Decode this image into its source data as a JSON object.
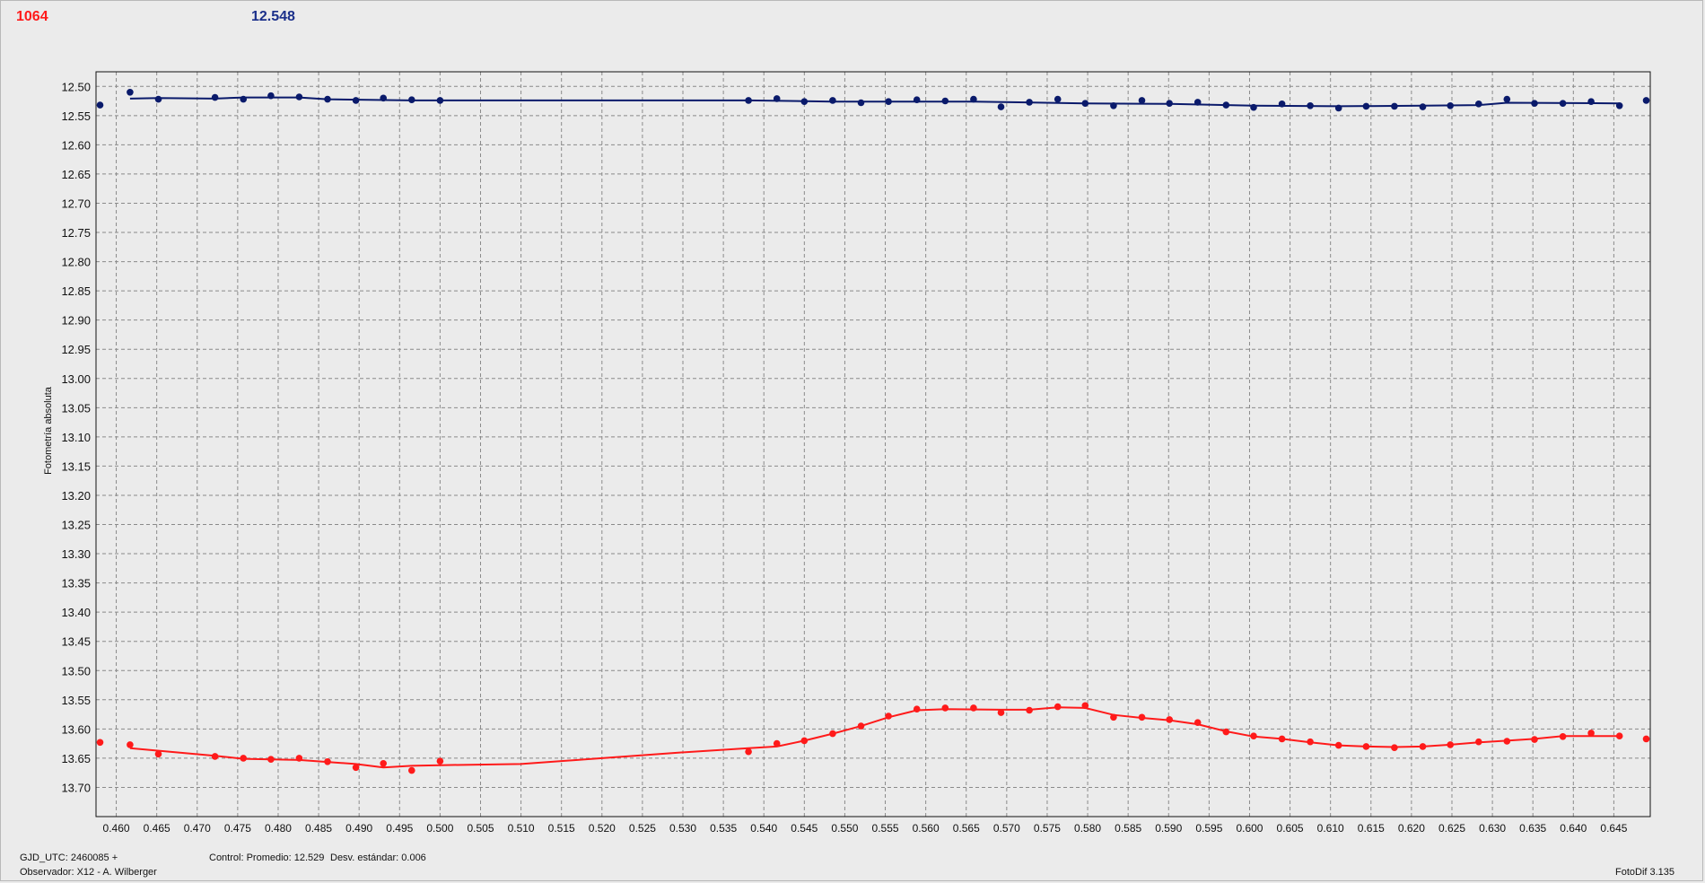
{
  "header": {
    "red_value": "1064",
    "blue_value": "12.548"
  },
  "footer": {
    "gjd": "GJD_UTC: 2460085 +",
    "observer": "Observador: X12 - A. Wilberger",
    "control": "Control: Promedio: 12.529",
    "desv": "Desv. estándar: 0.006",
    "app": "FotoDif 3.135"
  },
  "colors": {
    "blue": "#0a1a6b",
    "red": "#ff1a1a",
    "grid": "#8a8a8a",
    "background": "#ebebeb"
  },
  "chart_data": {
    "type": "scatter",
    "title": "",
    "xlabel": "",
    "ylabel": "Fotometría absoluta",
    "xlim": [
      0.4575,
      0.6495
    ],
    "ylim": [
      12.475,
      13.75
    ],
    "y_inverted": true,
    "grid": true,
    "x_ticks": [
      0.46,
      0.465,
      0.47,
      0.475,
      0.48,
      0.485,
      0.49,
      0.495,
      0.5,
      0.505,
      0.51,
      0.515,
      0.52,
      0.525,
      0.53,
      0.535,
      0.54,
      0.545,
      0.55,
      0.555,
      0.56,
      0.565,
      0.57,
      0.575,
      0.58,
      0.585,
      0.59,
      0.595,
      0.6,
      0.605,
      0.61,
      0.615,
      0.62,
      0.625,
      0.63,
      0.635,
      0.64,
      0.645
    ],
    "y_ticks": [
      12.5,
      12.55,
      12.6,
      12.65,
      12.7,
      12.75,
      12.8,
      12.85,
      12.9,
      12.95,
      13.0,
      13.05,
      13.1,
      13.15,
      13.2,
      13.25,
      13.3,
      13.35,
      13.4,
      13.45,
      13.5,
      13.55,
      13.6,
      13.65,
      13.7
    ],
    "series": [
      {
        "name": "",
        "color": "#0a1a6b",
        "points": [
          [
            0.458,
            12.532
          ],
          [
            0.4617,
            12.51
          ],
          [
            0.4652,
            12.522
          ],
          [
            0.4722,
            12.519
          ],
          [
            0.4757,
            12.522
          ],
          [
            0.4791,
            12.516
          ],
          [
            0.4826,
            12.518
          ],
          [
            0.4861,
            12.522
          ],
          [
            0.4896,
            12.524
          ],
          [
            0.493,
            12.52
          ],
          [
            0.4965,
            12.523
          ],
          [
            0.5,
            12.524
          ],
          [
            0.5381,
            12.524
          ],
          [
            0.5416,
            12.521
          ],
          [
            0.545,
            12.526
          ],
          [
            0.5485,
            12.524
          ],
          [
            0.552,
            12.528
          ],
          [
            0.5554,
            12.526
          ],
          [
            0.5589,
            12.523
          ],
          [
            0.5624,
            12.525
          ],
          [
            0.5659,
            12.522
          ],
          [
            0.5693,
            12.535
          ],
          [
            0.5728,
            12.527
          ],
          [
            0.5763,
            12.522
          ],
          [
            0.5797,
            12.529
          ],
          [
            0.5832,
            12.533
          ],
          [
            0.5867,
            12.524
          ],
          [
            0.5901,
            12.529
          ],
          [
            0.5936,
            12.527
          ],
          [
            0.5971,
            12.532
          ],
          [
            0.6005,
            12.536
          ],
          [
            0.604,
            12.53
          ],
          [
            0.6075,
            12.533
          ],
          [
            0.611,
            12.537
          ],
          [
            0.6144,
            12.534
          ],
          [
            0.6179,
            12.534
          ],
          [
            0.6214,
            12.535
          ],
          [
            0.6248,
            12.533
          ],
          [
            0.6283,
            12.53
          ],
          [
            0.6318,
            12.522
          ],
          [
            0.6352,
            12.529
          ],
          [
            0.6387,
            12.529
          ],
          [
            0.6422,
            12.526
          ],
          [
            0.6457,
            12.533
          ],
          [
            0.649,
            12.524
          ]
        ],
        "line": [
          [
            0.4617,
            12.521
          ],
          [
            0.4652,
            12.52
          ],
          [
            0.4722,
            12.521
          ],
          [
            0.4757,
            12.519
          ],
          [
            0.4826,
            12.519
          ],
          [
            0.4861,
            12.522
          ],
          [
            0.4965,
            12.524
          ],
          [
            0.5,
            12.524
          ],
          [
            0.5381,
            12.524
          ],
          [
            0.5485,
            12.526
          ],
          [
            0.5659,
            12.526
          ],
          [
            0.5797,
            12.529
          ],
          [
            0.5901,
            12.53
          ],
          [
            0.6005,
            12.533
          ],
          [
            0.611,
            12.534
          ],
          [
            0.6214,
            12.533
          ],
          [
            0.6283,
            12.532
          ],
          [
            0.6318,
            12.528
          ],
          [
            0.6457,
            12.529
          ]
        ]
      },
      {
        "name": "",
        "color": "#ff1a1a",
        "points": [
          [
            0.458,
            13.623
          ],
          [
            0.4617,
            13.627
          ],
          [
            0.4652,
            13.643
          ],
          [
            0.4722,
            13.647
          ],
          [
            0.4757,
            13.65
          ],
          [
            0.4791,
            13.652
          ],
          [
            0.4826,
            13.65
          ],
          [
            0.4861,
            13.656
          ],
          [
            0.4896,
            13.666
          ],
          [
            0.493,
            13.659
          ],
          [
            0.4965,
            13.671
          ],
          [
            0.5,
            13.655
          ],
          [
            0.5381,
            13.639
          ],
          [
            0.5416,
            13.625
          ],
          [
            0.545,
            13.62
          ],
          [
            0.5485,
            13.608
          ],
          [
            0.552,
            13.595
          ],
          [
            0.5554,
            13.578
          ],
          [
            0.5589,
            13.566
          ],
          [
            0.5624,
            13.564
          ],
          [
            0.5659,
            13.564
          ],
          [
            0.5693,
            13.572
          ],
          [
            0.5728,
            13.568
          ],
          [
            0.5763,
            13.562
          ],
          [
            0.5797,
            13.56
          ],
          [
            0.5832,
            13.58
          ],
          [
            0.5867,
            13.58
          ],
          [
            0.5901,
            13.584
          ],
          [
            0.5936,
            13.589
          ],
          [
            0.5971,
            13.605
          ],
          [
            0.6005,
            13.612
          ],
          [
            0.604,
            13.617
          ],
          [
            0.6075,
            13.622
          ],
          [
            0.611,
            13.628
          ],
          [
            0.6144,
            13.63
          ],
          [
            0.6179,
            13.632
          ],
          [
            0.6214,
            13.63
          ],
          [
            0.6248,
            13.627
          ],
          [
            0.6283,
            13.622
          ],
          [
            0.6318,
            13.621
          ],
          [
            0.6352,
            13.618
          ],
          [
            0.6387,
            13.613
          ],
          [
            0.6422,
            13.607
          ],
          [
            0.6457,
            13.612
          ],
          [
            0.649,
            13.617
          ]
        ],
        "line": [
          [
            0.4617,
            13.633
          ],
          [
            0.4722,
            13.646
          ],
          [
            0.4757,
            13.651
          ],
          [
            0.4826,
            13.653
          ],
          [
            0.4896,
            13.66
          ],
          [
            0.493,
            13.666
          ],
          [
            0.4965,
            13.663
          ],
          [
            0.5,
            13.662
          ],
          [
            0.51,
            13.66
          ],
          [
            0.52,
            13.65
          ],
          [
            0.53,
            13.64
          ],
          [
            0.5381,
            13.633
          ],
          [
            0.5416,
            13.63
          ],
          [
            0.545,
            13.62
          ],
          [
            0.5485,
            13.608
          ],
          [
            0.552,
            13.595
          ],
          [
            0.5554,
            13.58
          ],
          [
            0.5589,
            13.568
          ],
          [
            0.5624,
            13.566
          ],
          [
            0.5693,
            13.567
          ],
          [
            0.5728,
            13.567
          ],
          [
            0.5763,
            13.563
          ],
          [
            0.5797,
            13.564
          ],
          [
            0.5832,
            13.576
          ],
          [
            0.5867,
            13.581
          ],
          [
            0.5901,
            13.585
          ],
          [
            0.5936,
            13.592
          ],
          [
            0.5971,
            13.604
          ],
          [
            0.6005,
            13.613
          ],
          [
            0.604,
            13.617
          ],
          [
            0.6075,
            13.623
          ],
          [
            0.611,
            13.628
          ],
          [
            0.6144,
            13.63
          ],
          [
            0.6179,
            13.631
          ],
          [
            0.6214,
            13.63
          ],
          [
            0.6248,
            13.627
          ],
          [
            0.6283,
            13.623
          ],
          [
            0.6318,
            13.62
          ],
          [
            0.6352,
            13.617
          ],
          [
            0.6387,
            13.612
          ],
          [
            0.6457,
            13.612
          ]
        ]
      }
    ]
  }
}
